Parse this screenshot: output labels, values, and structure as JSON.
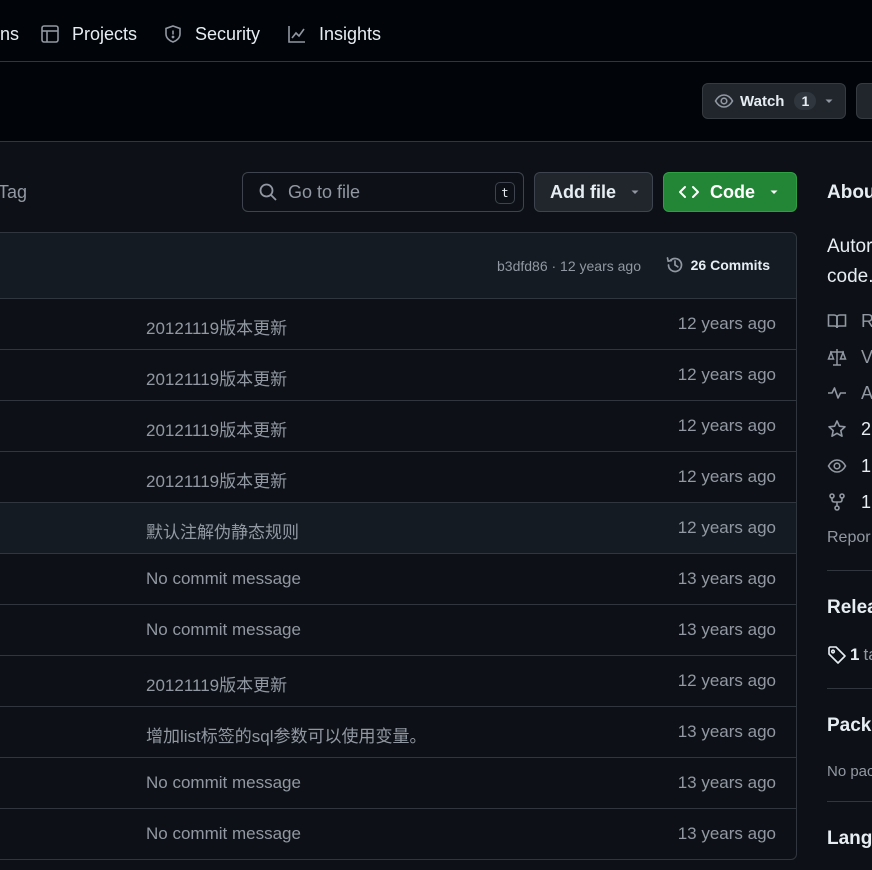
{
  "nav": {
    "actions_partial": "ns",
    "projects": "Projects",
    "security": "Security",
    "insights": "Insights"
  },
  "watch": {
    "label": "Watch",
    "count": "1"
  },
  "toolbar": {
    "tag_label": "Tag",
    "search_placeholder": "Go to file",
    "search_shortcut": "t",
    "add_file": "Add file",
    "code": "Code"
  },
  "commit": {
    "meta": "b3dfd86 · 12 years ago",
    "commits_count": "26 Commits"
  },
  "files": [
    {
      "message": "20121119版本更新",
      "time": "12 years ago"
    },
    {
      "message": "20121119版本更新",
      "time": "12 years ago"
    },
    {
      "message": "20121119版本更新",
      "time": "12 years ago"
    },
    {
      "message": "20121119版本更新",
      "time": "12 years ago"
    },
    {
      "message": "默认注解伪静态规则",
      "time": "12 years ago"
    },
    {
      "message": "No commit message",
      "time": "13 years ago"
    },
    {
      "message": "No commit message",
      "time": "13 years ago"
    },
    {
      "message": "20121119版本更新",
      "time": "12 years ago"
    },
    {
      "message": "增加list标签的sql参数可以使用变量。",
      "time": "13 years ago"
    },
    {
      "message": "No commit message",
      "time": "13 years ago"
    },
    {
      "message": "No commit message",
      "time": "13 years ago"
    }
  ],
  "sidebar": {
    "about_heading": "Abou",
    "description_line1": "Autor",
    "description_line2": "code.",
    "readme": "R",
    "license": "V",
    "activity": "A",
    "stars": "2",
    "watchers": "1",
    "forks": "1",
    "report": "Repor",
    "releases_heading": "Relea",
    "tags_count": "1",
    "tags_word": "ta",
    "packages_heading": "Packa",
    "no_packages": "No pac",
    "languages_heading": "Lang"
  },
  "colors": {
    "background": "#0d1117",
    "nav_background": "#010409",
    "border": "#30363d",
    "primary_button": "#238636",
    "muted_text": "#9198a1"
  }
}
